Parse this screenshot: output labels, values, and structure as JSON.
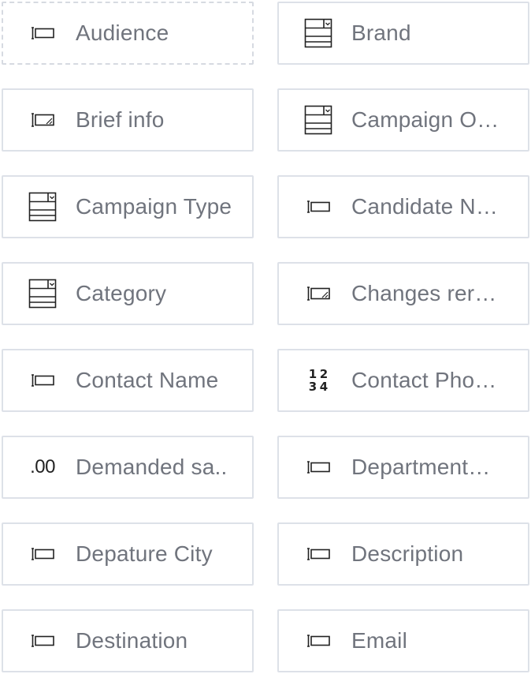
{
  "fields": [
    {
      "label": "Audience",
      "icon": "text-field-icon",
      "dashed": true
    },
    {
      "label": "Brand",
      "icon": "dropdown-icon"
    },
    {
      "label": "Brief info",
      "icon": "textarea-icon"
    },
    {
      "label": "Campaign Ob…",
      "icon": "dropdown-icon"
    },
    {
      "label": "Campaign Type",
      "icon": "dropdown-icon"
    },
    {
      "label": "Candidate Na…",
      "icon": "text-field-icon"
    },
    {
      "label": "Category",
      "icon": "dropdown-icon"
    },
    {
      "label": "Changes rer…",
      "icon": "textarea-icon"
    },
    {
      "label": "Contact Name",
      "icon": "text-field-icon"
    },
    {
      "label": "Contact Pho…",
      "icon": "number-icon"
    },
    {
      "label": "Demanded sa..",
      "icon": "decimal-icon"
    },
    {
      "label": "Department…",
      "icon": "text-field-icon"
    },
    {
      "label": "Depature City",
      "icon": "text-field-icon"
    },
    {
      "label": "Description",
      "icon": "text-field-icon"
    },
    {
      "label": "Destination",
      "icon": "text-field-icon"
    },
    {
      "label": "Email",
      "icon": "text-field-icon"
    }
  ],
  "icon_glyphs": {
    "number": [
      "1",
      "2",
      "3",
      "4"
    ],
    "decimal": ".00"
  },
  "colors": {
    "border": "#dde1e8",
    "label": "#70747d",
    "icon": "#222222"
  }
}
